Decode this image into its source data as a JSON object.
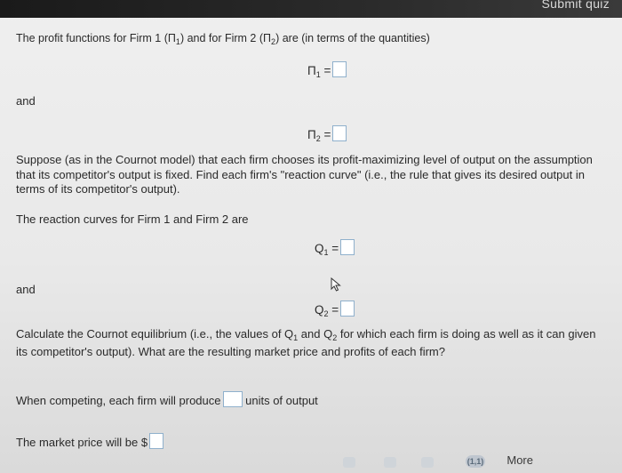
{
  "header": {
    "submit_label": "Submit quiz"
  },
  "question": {
    "intro": "The profit functions for Firm 1 (Π",
    "intro_sub1": "1",
    "intro_mid": ") and for Firm 2 (Π",
    "intro_sub2": "2",
    "intro_end": ") are (in terms of the quantities)",
    "pi1_symbol": "Π",
    "pi1_sub": "1",
    "pi2_symbol": "Π",
    "pi2_sub": "2",
    "equals": "=",
    "and_label_1": "and",
    "paragraph": "Suppose (as in the Cournot model) that each firm chooses its profit-maximizing level of output on the assumption that its competitor's output is fixed. Find each firm's \"reaction curve\" (i.e., the rule that gives its desired output in terms of its competitor's output).",
    "reaction_intro": "The reaction curves for Firm 1 and Firm 2 are",
    "q1_symbol": "Q",
    "q1_sub": "1",
    "and_label_2": "and",
    "q2_symbol": "Q",
    "q2_sub": "2",
    "calc_line1_a": "Calculate the Cournot equilibrium (i.e., the values of Q",
    "calc_line1_sub1": "1",
    "calc_line1_b": " and Q",
    "calc_line1_sub2": "2",
    "calc_line1_c": " for which each firm is doing as well as it can given",
    "calc_line2": "its competitor's output). What are the resulting market price and profits of each firm?",
    "competing_prefix": "When competing, each firm will produce",
    "competing_suffix": "units of output",
    "price_prefix": "The market price will be $"
  },
  "footer": {
    "more_label": "More",
    "help_icon_text": "(1,1)"
  }
}
